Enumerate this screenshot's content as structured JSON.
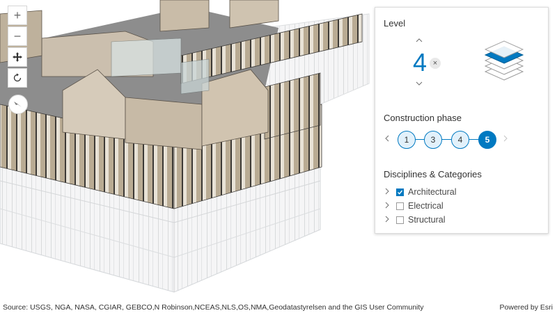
{
  "toolbar": {
    "zoom_in": "+",
    "zoom_out": "−",
    "pan_icon": "pan-icon",
    "rotate_icon": "rotate-icon",
    "compass_icon": "compass-icon"
  },
  "panel": {
    "level": {
      "title": "Level",
      "value": "4",
      "clear": "×"
    },
    "construction_phase": {
      "title": "Construction phase",
      "phases": [
        "1",
        "3",
        "4",
        "5"
      ],
      "active": "5"
    },
    "disciplines": {
      "title": "Disciplines & Categories",
      "items": [
        {
          "label": "Architectural",
          "checked": true
        },
        {
          "label": "Electrical",
          "checked": false
        },
        {
          "label": "Structural",
          "checked": false
        }
      ]
    }
  },
  "attribution": {
    "source": "Source: USGS, NGA, NASA, CGIAR, GEBCO,N Robinson,NCEAS,NLS,OS,NMA,Geodatastyrelsen and the GIS User Community",
    "powered": "Powered by Esri"
  },
  "colors": {
    "accent": "#0079c1",
    "wall": "#cbbfae",
    "floor": "#8a8a8a"
  }
}
